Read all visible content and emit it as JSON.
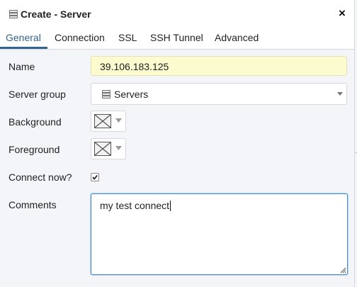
{
  "dialog": {
    "title": "Create - Server",
    "title_icon": "servers-icon",
    "close_icon": "close-icon",
    "close_label": "×"
  },
  "tabs": [
    {
      "label": "General",
      "active": true
    },
    {
      "label": "Connection",
      "active": false
    },
    {
      "label": "SSL",
      "active": false
    },
    {
      "label": "SSH Tunnel",
      "active": false
    },
    {
      "label": "Advanced",
      "active": false
    }
  ],
  "form": {
    "name": {
      "label": "Name",
      "value": "39.106.183.125"
    },
    "server_group": {
      "label": "Server group",
      "value": "Servers",
      "icon": "servers-icon"
    },
    "background": {
      "label": "Background",
      "value_icon": "no-color-icon"
    },
    "foreground": {
      "label": "Foreground",
      "value_icon": "no-color-icon"
    },
    "connect_now": {
      "label": "Connect now?",
      "checked": true
    },
    "comments": {
      "label": "Comments",
      "value": "my test connect"
    }
  },
  "colors": {
    "accent": "#326690",
    "name_field_bg": "#fbfbcf",
    "focus_border": "#4a8fcf",
    "panel_bg": "#f3f5f8"
  }
}
